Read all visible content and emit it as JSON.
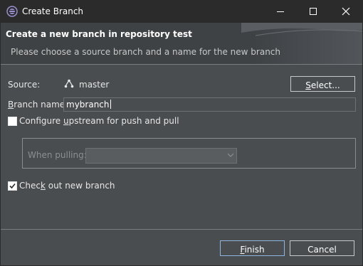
{
  "window": {
    "title": "Create Branch"
  },
  "header": {
    "title": "Create a new branch in repository test",
    "subtitle": "Please choose a source branch and a name for the new branch"
  },
  "form": {
    "source_label": "Source:",
    "source_value": "master",
    "select_button": {
      "pre": "",
      "mn": "S",
      "post": "elect..."
    },
    "branch_name_label": {
      "pre": "",
      "mn": "B",
      "post": "ranch name:"
    },
    "branch_name_value": "mybranch",
    "configure_upstream": {
      "pre": "Configure ",
      "mn": "u",
      "post": "pstream for push and pull",
      "checked": false
    },
    "when_pulling_label": "When pulling:",
    "when_pulling_value": "",
    "checkout": {
      "pre": "Chec",
      "mn": "k",
      "post": " out new branch",
      "checked": true
    }
  },
  "footer": {
    "finish": {
      "pre": "",
      "mn": "F",
      "post": "inish"
    },
    "cancel": "Cancel"
  },
  "icons": {
    "app": "eclipse-app-icon",
    "branch": "branch-icon"
  },
  "colors": {
    "accent": "#8fb6e0",
    "background": "#4a4d50",
    "titlebar": "#2b2b2b"
  }
}
